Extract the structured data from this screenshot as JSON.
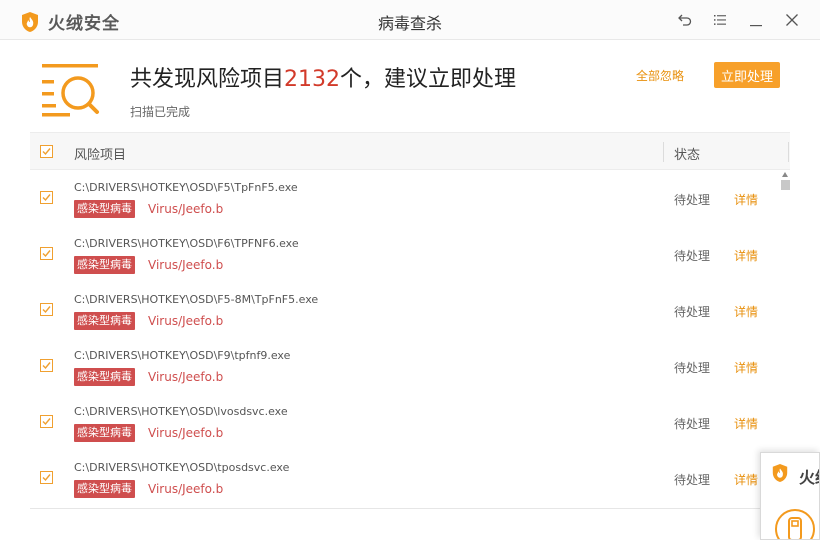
{
  "app": {
    "brand": "火绒安全",
    "window_title": "病毒查杀"
  },
  "header": {
    "headline_prefix": "共发现风险项目",
    "risk_count": "2132",
    "headline_suffix": "个，建议立即处理",
    "scan_status": "扫描已完成",
    "ignore_all_label": "全部忽略",
    "handle_now_label": "立即处理"
  },
  "table": {
    "col_risk": "风险项目",
    "col_status": "状态",
    "rows": [
      {
        "path": "C:\\DRIVERS\\HOTKEY\\OSD\\F5\\TpFnF5.exe",
        "tag": "感染型病毒",
        "virus": "Virus/Jeefo.b",
        "status": "待处理",
        "detail": "详情"
      },
      {
        "path": "C:\\DRIVERS\\HOTKEY\\OSD\\F6\\TPFNF6.exe",
        "tag": "感染型病毒",
        "virus": "Virus/Jeefo.b",
        "status": "待处理",
        "detail": "详情"
      },
      {
        "path": "C:\\DRIVERS\\HOTKEY\\OSD\\F5-8M\\TpFnF5.exe",
        "tag": "感染型病毒",
        "virus": "Virus/Jeefo.b",
        "status": "待处理",
        "detail": "详情"
      },
      {
        "path": "C:\\DRIVERS\\HOTKEY\\OSD\\F9\\tpfnf9.exe",
        "tag": "感染型病毒",
        "virus": "Virus/Jeefo.b",
        "status": "待处理",
        "detail": "详情"
      },
      {
        "path": "C:\\DRIVERS\\HOTKEY\\OSD\\lvosdsvc.exe",
        "tag": "感染型病毒",
        "virus": "Virus/Jeefo.b",
        "status": "待处理",
        "detail": "详情"
      },
      {
        "path": "C:\\DRIVERS\\HOTKEY\\OSD\\tposdsvc.exe",
        "tag": "感染型病毒",
        "virus": "Virus/Jeefo.b",
        "status": "待处理",
        "detail": "详情"
      }
    ]
  },
  "popup": {
    "brand": "火绒"
  },
  "icons": {
    "brand_logo": "flame-shield-icon",
    "back": "back-arrow-icon",
    "menu": "menu-list-icon",
    "minimize": "minimize-icon",
    "close": "close-icon",
    "scan_illustration": "scan-document-magnifier-icon",
    "checkbox": "checkbox-checked-icon",
    "usb": "usb-drive-icon"
  },
  "colors": {
    "accent_orange": "#f7a02a",
    "link_orange": "#e8900d",
    "danger_red": "#d23a2a",
    "tag_red": "#cf4e4e"
  }
}
